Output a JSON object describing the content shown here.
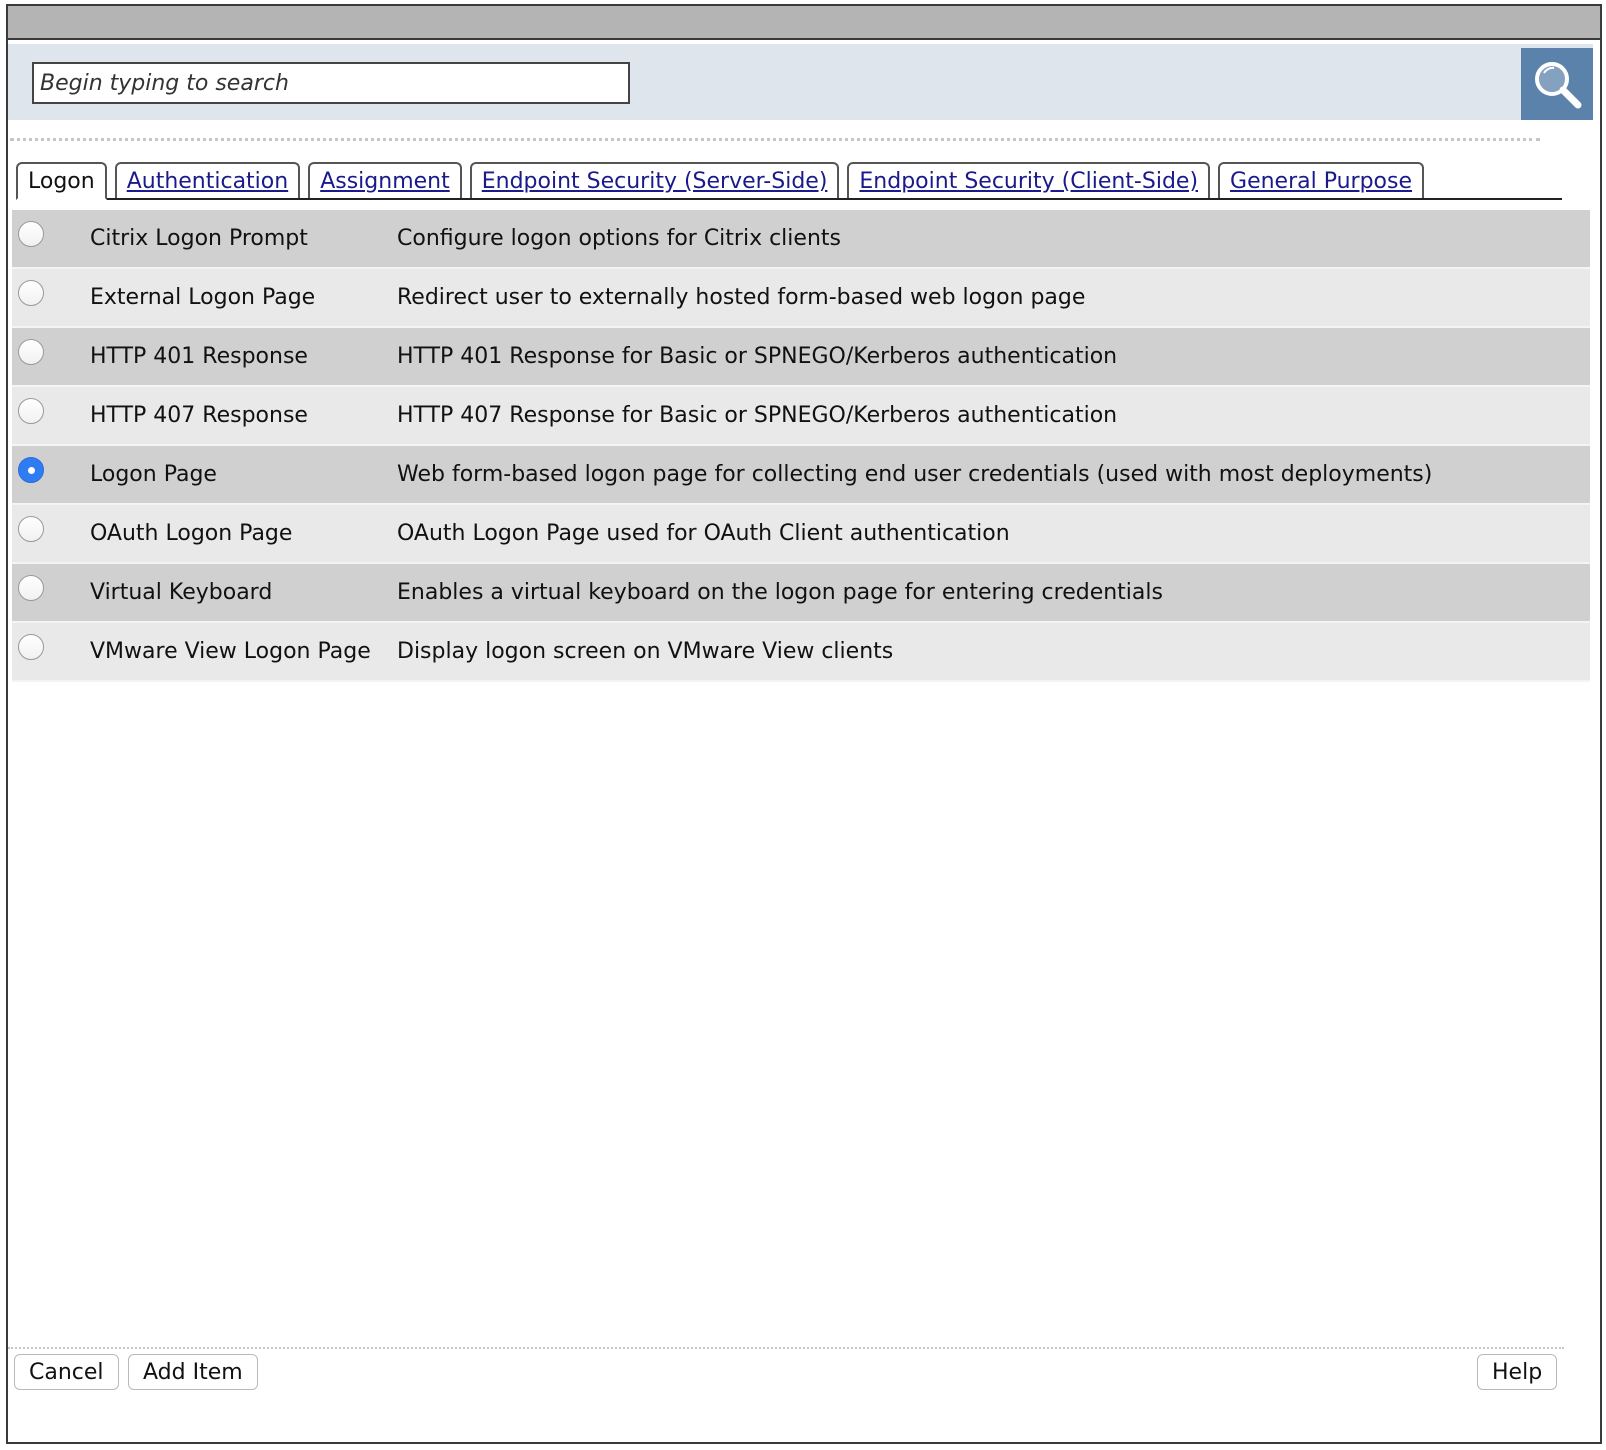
{
  "search": {
    "placeholder": "Begin typing to search"
  },
  "tabs": [
    {
      "label": "Logon",
      "active": true
    },
    {
      "label": "Authentication",
      "active": false
    },
    {
      "label": "Assignment",
      "active": false
    },
    {
      "label": "Endpoint Security (Server-Side)",
      "active": false
    },
    {
      "label": "Endpoint Security (Client-Side)",
      "active": false
    },
    {
      "label": "General Purpose",
      "active": false
    }
  ],
  "items": [
    {
      "name": "Citrix Logon Prompt",
      "description": "Configure logon options for Citrix clients",
      "selected": false
    },
    {
      "name": "External Logon Page",
      "description": "Redirect user to externally hosted form-based web logon page",
      "selected": false
    },
    {
      "name": "HTTP 401 Response",
      "description": "HTTP 401 Response for Basic or SPNEGO/Kerberos authentication",
      "selected": false
    },
    {
      "name": "HTTP 407 Response",
      "description": "HTTP 407 Response for Basic or SPNEGO/Kerberos authentication",
      "selected": false
    },
    {
      "name": "Logon Page",
      "description": "Web form-based logon page for collecting end user credentials (used with most deployments)",
      "selected": true
    },
    {
      "name": "OAuth Logon Page",
      "description": "OAuth Logon Page used for OAuth Client authentication",
      "selected": false
    },
    {
      "name": "Virtual Keyboard",
      "description": "Enables a virtual keyboard on the logon page for entering credentials",
      "selected": false
    },
    {
      "name": "VMware View Logon Page",
      "description": "Display logon screen on VMware View clients",
      "selected": false
    }
  ],
  "footer": {
    "cancel_label": "Cancel",
    "add_label": "Add Item",
    "help_label": "Help"
  },
  "colors": {
    "search_button": "#5b82ab",
    "search_bar": "#dfe5ec",
    "row_dark": "#d0d0d0",
    "row_light": "#e9e9e9",
    "radio_selected": "#2f7bf2",
    "link": "#1a1a8c"
  },
  "icons": {
    "search": "magnifier-icon"
  }
}
